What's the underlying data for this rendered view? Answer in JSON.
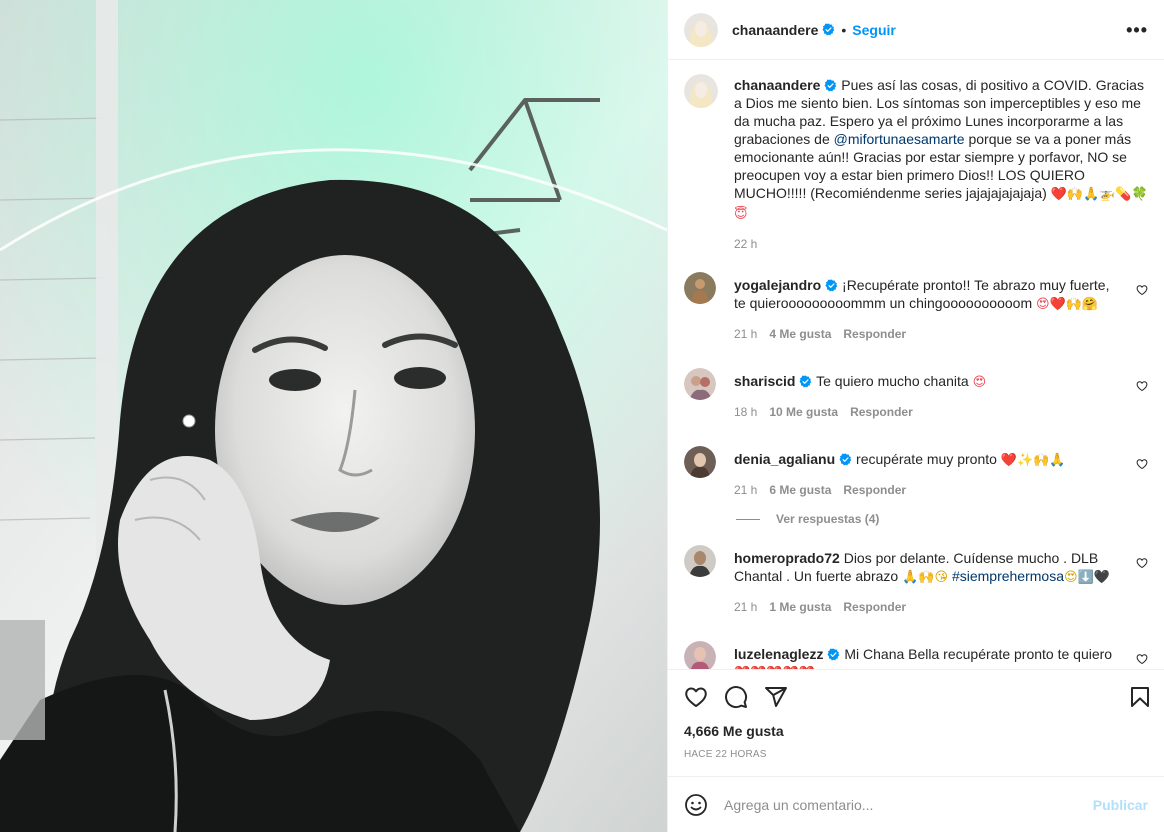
{
  "post": {
    "author": "chanaandere",
    "follow_label": "Seguir",
    "dot": "•",
    "more_label": "•••",
    "caption_author": "chanaandere",
    "caption_text_1": "Pues así las cosas, di positivo a COVID. Gracias a Dios me siento bien. Los síntomas son imperceptibles y eso me da mucha paz. Espero ya el próximo Lunes incorporarme a las grabaciones de ",
    "caption_mention": "@mifortunaesamarte",
    "caption_text_2": " porque se va a poner más emocionante aún!! Gracias por estar siempre y porfavor, NO se preocupen voy a estar bien primero Dios!! LOS QUIERO MUCHO!!!!! (Recomiéndenme series jajajajajajaja) ",
    "caption_emojis": "❤️🙌🙏🚁💊🍀😇",
    "caption_time": "22 h"
  },
  "comments": [
    {
      "user": "yogalejandro",
      "text": "¡Recupérate pronto!! Te abrazo muy fuerte, te quierooooooooommm un chingoooooooooom ",
      "emojis": "😍❤️🙌🤗",
      "time": "21 h",
      "likes": "4 Me gusta",
      "reply": "Responder"
    },
    {
      "user": "shariscid",
      "text": "Te quiero mucho chanita ",
      "emojis": "😍",
      "time": "18 h",
      "likes": "10 Me gusta",
      "reply": "Responder"
    },
    {
      "user": "denia_agalianu",
      "text": "recupérate muy pronto ",
      "emojis": "❤️✨🙌🙏",
      "time": "21 h",
      "likes": "6 Me gusta",
      "reply": "Responder",
      "view_replies": "Ver respuestas (4)"
    },
    {
      "user": "homeroprado72",
      "text": "Dios por delante. Cuídense mucho . DLB Chantal . Un fuerte abrazo ",
      "emojis": "🙏🙌😘",
      "hashtag": "#siemprehermosa",
      "emojis_after": "😍⬇️🖤",
      "time": "21 h",
      "likes": "1 Me gusta",
      "reply": "Responder"
    },
    {
      "user": "luzelenaglezz",
      "text": "Mi Chana Bella recupérate pronto te quiero ",
      "emojis": "❤️❤️❤️❤️❤️"
    }
  ],
  "footer": {
    "likes": "4,666 Me gusta",
    "ago": "HACE 22 HORAS",
    "comment_placeholder": "Agrega un comentario...",
    "publish_label": "Publicar"
  },
  "icons": {
    "verified": "verified-badge-icon",
    "like": "heart-icon",
    "comment": "comment-bubble-icon",
    "share": "paper-plane-icon",
    "save": "bookmark-icon",
    "emoji": "smiley-icon"
  },
  "colors": {
    "link_blue": "#0095f6",
    "mention": "#00376b",
    "muted": "#8e8e8e",
    "publish_disabled": "#b2dffc",
    "heart_red": "#ed4956"
  }
}
